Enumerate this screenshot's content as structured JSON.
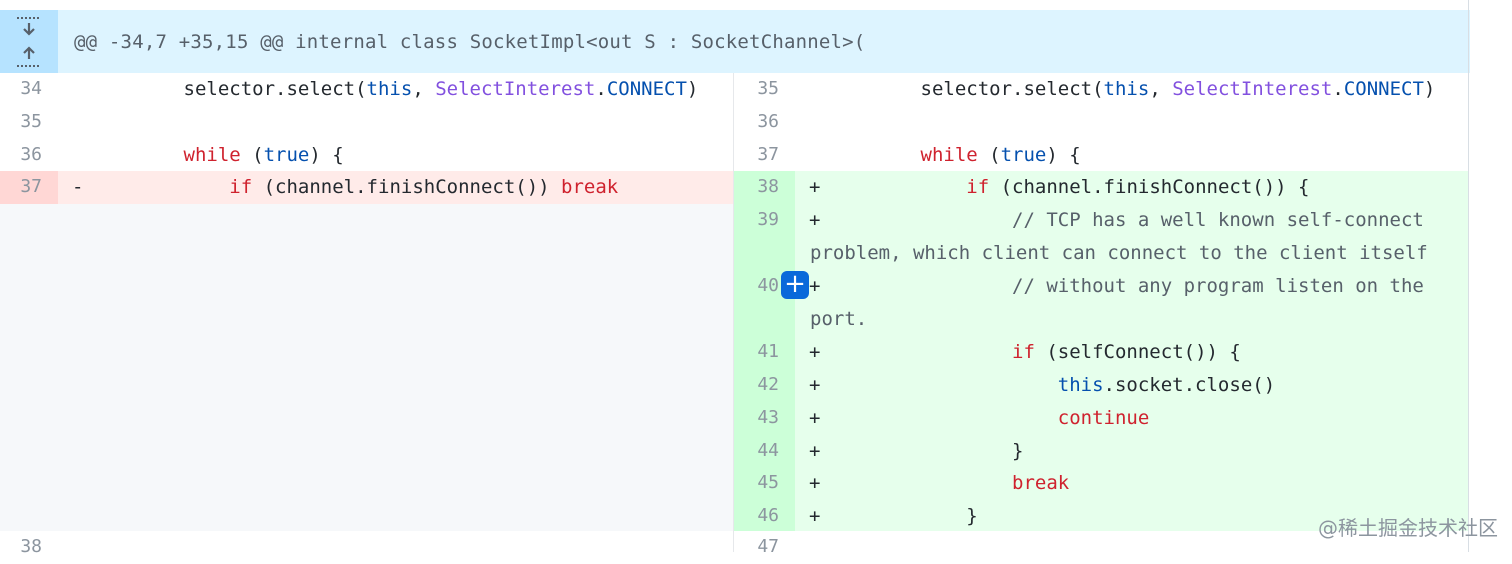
{
  "hunk": {
    "header": "@@ -34,7 +35,15 @@ internal class SocketImpl<out S : SocketChannel>(",
    "expand_down_icon": "arrow-down-icon",
    "expand_up_icon": "arrow-up-icon"
  },
  "left": {
    "lines": [
      {
        "num": "34",
        "marker": "",
        "tokens": [
          [
            "        selector.select(",
            "p"
          ],
          [
            "this",
            "bl"
          ],
          [
            ", ",
            "p"
          ],
          [
            "SelectInterest",
            "pu"
          ],
          [
            ".",
            "p"
          ],
          [
            "CONNECT",
            "bl"
          ],
          [
            ")",
            "p"
          ]
        ]
      },
      {
        "num": "35",
        "marker": "",
        "tokens": []
      },
      {
        "num": "36",
        "marker": "",
        "tokens": [
          [
            "        ",
            "p"
          ],
          [
            "while",
            "kw"
          ],
          [
            " (",
            "p"
          ],
          [
            "true",
            "bl"
          ],
          [
            ") {",
            "p"
          ]
        ]
      },
      {
        "num": "37",
        "marker": "-",
        "tokens": [
          [
            "            ",
            "p"
          ],
          [
            "if",
            "kw"
          ],
          [
            " (channel.finishConnect()) ",
            "p"
          ],
          [
            "break",
            "kw"
          ]
        ]
      },
      {
        "num": "38",
        "marker": "",
        "tokens": []
      }
    ]
  },
  "right": {
    "lines": [
      {
        "num": "35",
        "marker": "",
        "tokens": [
          [
            "        selector.select(",
            "p"
          ],
          [
            "this",
            "bl"
          ],
          [
            ", ",
            "p"
          ],
          [
            "SelectInterest",
            "pu"
          ],
          [
            ".",
            "p"
          ],
          [
            "CONNECT",
            "bl"
          ],
          [
            ")",
            "p"
          ]
        ]
      },
      {
        "num": "36",
        "marker": "",
        "tokens": []
      },
      {
        "num": "37",
        "marker": "",
        "tokens": [
          [
            "        ",
            "p"
          ],
          [
            "while",
            "kw"
          ],
          [
            " (",
            "p"
          ],
          [
            "true",
            "bl"
          ],
          [
            ") {",
            "p"
          ]
        ]
      },
      {
        "num": "38",
        "marker": "+",
        "tokens": [
          [
            "            ",
            "p"
          ],
          [
            "if",
            "kw"
          ],
          [
            " (channel.finishConnect()) {",
            "p"
          ]
        ]
      },
      {
        "num": "39",
        "marker": "+",
        "tokens": [
          [
            "                ",
            "p"
          ],
          [
            "// TCP has a well known self-connect",
            "cm"
          ]
        ],
        "wrap": [
          [
            "problem, which client can connect to the client itself",
            "cm"
          ]
        ]
      },
      {
        "num": "40",
        "marker": "+",
        "tokens": [
          [
            "                ",
            "p"
          ],
          [
            "// without any program listen on the",
            "cm"
          ]
        ],
        "wrap": [
          [
            "port.",
            "cm"
          ]
        ]
      },
      {
        "num": "41",
        "marker": "+",
        "tokens": [
          [
            "                ",
            "p"
          ],
          [
            "if",
            "kw"
          ],
          [
            " (selfConnect()) {",
            "p"
          ]
        ]
      },
      {
        "num": "42",
        "marker": "+",
        "tokens": [
          [
            "                    ",
            "p"
          ],
          [
            "this",
            "bl"
          ],
          [
            ".socket.close()",
            "p"
          ]
        ]
      },
      {
        "num": "43",
        "marker": "+",
        "tokens": [
          [
            "                    ",
            "p"
          ],
          [
            "continue",
            "kw"
          ]
        ]
      },
      {
        "num": "44",
        "marker": "+",
        "tokens": [
          [
            "                }",
            "p"
          ]
        ]
      },
      {
        "num": "45",
        "marker": "+",
        "tokens": [
          [
            "                ",
            "p"
          ],
          [
            "break",
            "kw"
          ]
        ]
      },
      {
        "num": "46",
        "marker": "+",
        "tokens": [
          [
            "            }",
            "p"
          ]
        ]
      },
      {
        "num": "47",
        "marker": "",
        "tokens": []
      }
    ]
  },
  "add_comment": {
    "label": "+",
    "icon": "plus-icon"
  },
  "watermark": "@稀土掘金技术社区",
  "colors": {
    "hunk_bg": "#ddf4ff",
    "hunk_gutter": "#b6e3ff",
    "del_gutter": "#ffd7d5",
    "del_bg": "#ffebe9",
    "add_gutter": "#ccffd8",
    "add_bg": "#e6ffec",
    "keyword": "#cf222e",
    "constant": "#0550ae",
    "type": "#8250df",
    "comment": "#57606a",
    "accent": "#0969da"
  }
}
